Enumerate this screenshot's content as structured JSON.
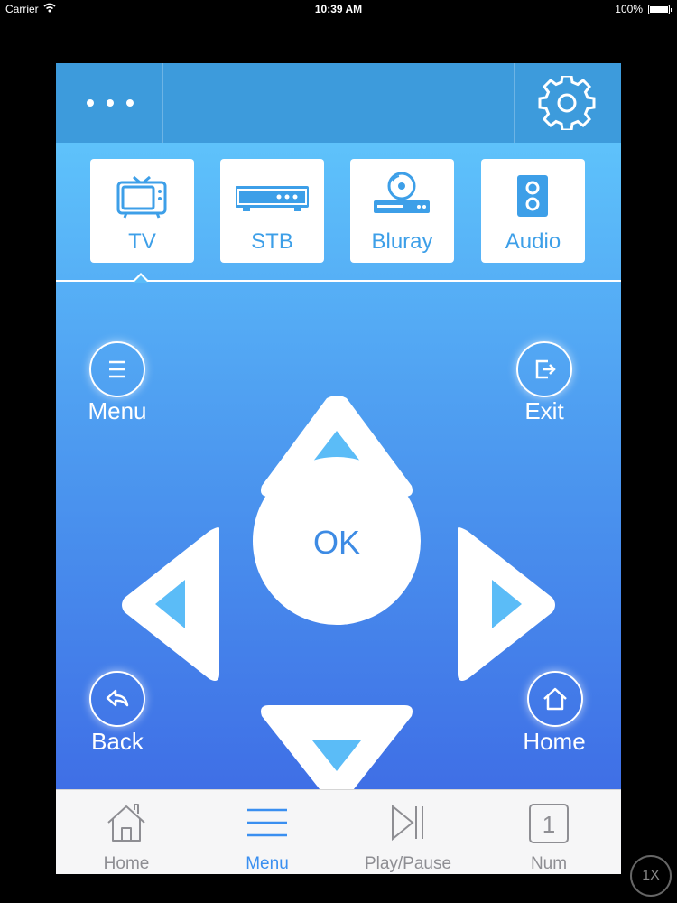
{
  "status_bar": {
    "carrier": "Carrier",
    "time": "10:39 AM",
    "battery": "100%"
  },
  "header": {
    "more_icon": "ellipsis-icon",
    "settings_icon": "gear-icon"
  },
  "devices": [
    {
      "label": "TV",
      "icon": "tv-icon",
      "selected": true
    },
    {
      "label": "STB",
      "icon": "set-top-box-icon",
      "selected": false
    },
    {
      "label": "Bluray",
      "icon": "bluray-player-icon",
      "selected": false
    },
    {
      "label": "Audio",
      "icon": "speaker-icon",
      "selected": false
    }
  ],
  "remote": {
    "menu_label": "Menu",
    "exit_label": "Exit",
    "back_label": "Back",
    "home_label": "Home",
    "ok_label": "OK"
  },
  "tabbar": {
    "tabs": [
      {
        "label": "Home",
        "icon": "house-icon",
        "active": false
      },
      {
        "label": "Menu",
        "icon": "hamburger-icon",
        "active": true
      },
      {
        "label": "Play/Pause",
        "icon": "play-pause-icon",
        "active": false
      },
      {
        "label": "Num",
        "icon": "number-pad-icon",
        "icon_text": "1",
        "active": false
      }
    ]
  },
  "zoom_badge": "1X",
  "colors": {
    "header": "#3d9bdc",
    "gradient_top": "#5ec2fb",
    "gradient_bottom": "#3f6fe6",
    "accent": "#3a8ff0",
    "arrow_fill": "#5bbcf7"
  }
}
